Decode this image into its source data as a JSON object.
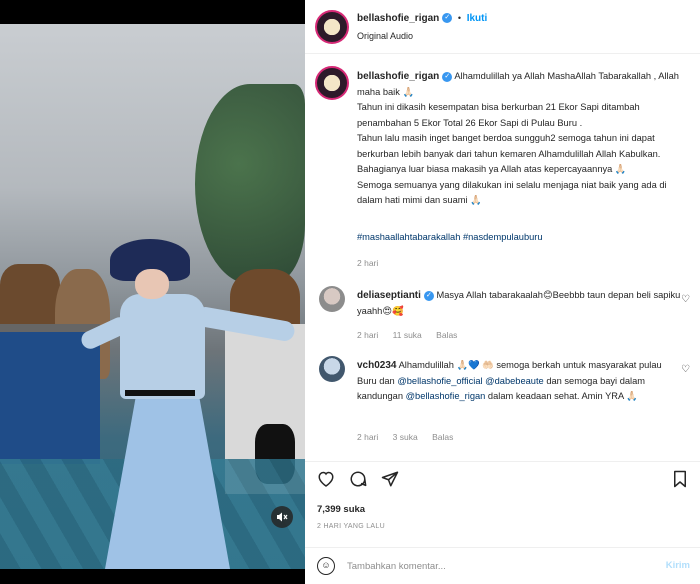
{
  "media": {
    "mute_icon": "speaker-muted-icon"
  },
  "header": {
    "username": "bellashofie_rigan",
    "follow_label": "Ikuti",
    "separator": "•",
    "audio": "Original Audio"
  },
  "caption": {
    "username": "bellashofie_rigan",
    "text": "Alhamdulillah ya Allah MashaAllah Tabarakallah , Allah maha baik 🙏🏻\nTahun ini dikasih kesempatan bisa berkurban 21 Ekor Sapi ditambah penambahan 5 Ekor Total 26 Ekor Sapi di Pulau Buru .\nTahun lalu masih inget banget berdoa sungguh2 semoga tahun ini dapat berkurban lebih banyak dari tahun kemaren Alhamdulillah Allah Kabulkan.\nBahagianya luar biasa makasih ya Allah atas kepercayaannya 🙏🏻\nSemoga semuanya yang dilakukan ini selalu menjaga niat baik yang ada di dalam hati mimi dan suami 🙏🏻",
    "hashtags": "#mashaallahtabarakallah #nasdempulauburu",
    "time": "2 hari"
  },
  "comments": [
    {
      "username": "deliaseptianti",
      "text": "Masya Allah tabarakaalah😊Beebbb taun depan beli sapiku yaahh😍🥰",
      "time": "2 hari",
      "likes": "11 suka",
      "reply": "Balas"
    },
    {
      "username": "vch0234",
      "text_a": "Alhamdulillah 🙏🏻💙 🤲🏻 semoga berkah untuk masyarakat pulau Buru dan ",
      "mention1": "@bellashofie_official",
      "mention2": "@dabebeaute",
      "text_b": " dan semoga bayi dalam kandungan ",
      "mention3": "@bellashofie_rigan",
      "text_c": " dalam keadaan sehat. Amin YRA 🙏🏻",
      "time": "2 hari",
      "likes": "3 suka",
      "reply": "Balas"
    }
  ],
  "actions": {
    "likes": "7,399 suka",
    "date": "2 HARI YANG LALU"
  },
  "compose": {
    "placeholder": "Tambahkan komentar...",
    "send_label": "Kirim"
  }
}
